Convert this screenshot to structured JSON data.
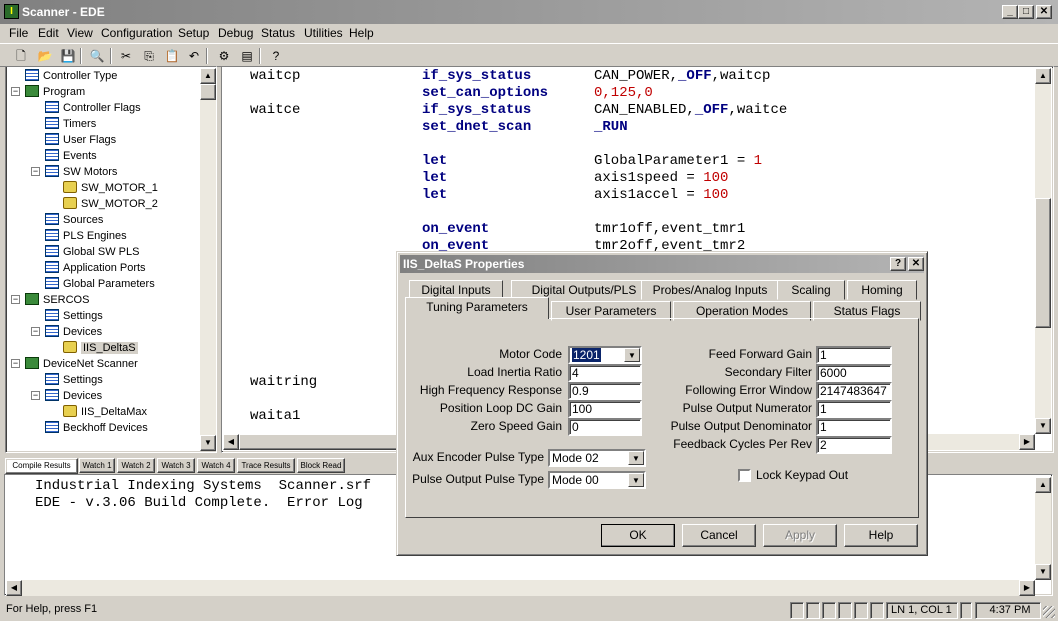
{
  "window": {
    "title": "Scanner - EDE",
    "app_icon": "I"
  },
  "menu": [
    "File",
    "Edit",
    "View",
    "Configuration",
    "Setup",
    "Debug",
    "Status",
    "Utilities",
    "Help"
  ],
  "toolbar": {
    "icons": [
      "new-file-icon",
      "open-folder-icon",
      "save-icon",
      "find-icon",
      "cut-icon",
      "copy-icon",
      "paste-icon",
      "undo-icon",
      "compile-icon",
      "build-icon",
      "help-icon"
    ]
  },
  "tree": {
    "items": [
      {
        "label": "Controller Type",
        "depth": 1,
        "icon": "grid"
      },
      {
        "label": "Program",
        "depth": 0,
        "icon": "folder",
        "expander": "−"
      },
      {
        "label": "Controller Flags",
        "depth": 2,
        "icon": "grid"
      },
      {
        "label": "Timers",
        "depth": 2,
        "icon": "grid"
      },
      {
        "label": "User Flags",
        "depth": 2,
        "icon": "grid"
      },
      {
        "label": "Events",
        "depth": 2,
        "icon": "grid"
      },
      {
        "label": "SW Motors",
        "depth": 2,
        "icon": "grid",
        "expander": "−"
      },
      {
        "label": "SW_MOTOR_1",
        "depth": 3,
        "icon": "dev"
      },
      {
        "label": "SW_MOTOR_2",
        "depth": 3,
        "icon": "dev"
      },
      {
        "label": "Sources",
        "depth": 2,
        "icon": "grid"
      },
      {
        "label": "PLS Engines",
        "depth": 2,
        "icon": "grid"
      },
      {
        "label": "Global SW PLS",
        "depth": 2,
        "icon": "grid"
      },
      {
        "label": "Application Ports",
        "depth": 2,
        "icon": "grid"
      },
      {
        "label": "Global Parameters",
        "depth": 2,
        "icon": "grid"
      },
      {
        "label": "SERCOS",
        "depth": 0,
        "icon": "folder",
        "expander": "−"
      },
      {
        "label": "Settings",
        "depth": 2,
        "icon": "grid"
      },
      {
        "label": "Devices",
        "depth": 2,
        "icon": "grid",
        "expander": "−"
      },
      {
        "label": "IIS_DeltaS",
        "depth": 3,
        "icon": "dev",
        "selected": true
      },
      {
        "label": "DeviceNet Scanner",
        "depth": 0,
        "icon": "folder",
        "expander": "−"
      },
      {
        "label": "Settings",
        "depth": 2,
        "icon": "grid"
      },
      {
        "label": "Devices",
        "depth": 2,
        "icon": "grid",
        "expander": "−"
      },
      {
        "label": "IIS_DeltaMax",
        "depth": 3,
        "icon": "dev"
      },
      {
        "label": "Beckhoff Devices",
        "depth": 2,
        "icon": "grid"
      }
    ]
  },
  "editor": {
    "lines": [
      {
        "label": "waitcp",
        "cmd": "if_sys_status",
        "args": [
          [
            "CAN_POWER,",
            ""
          ],
          [
            "_OFF",
            "kw"
          ],
          [
            ",waitcp",
            ""
          ]
        ]
      },
      {
        "label": "",
        "cmd": "set_can_options",
        "args": [
          [
            "0,125,0",
            "num"
          ]
        ]
      },
      {
        "label": "waitce",
        "cmd": "if_sys_status",
        "args": [
          [
            "CAN_ENABLED,",
            ""
          ],
          [
            "_OFF",
            "kw"
          ],
          [
            ",waitce",
            ""
          ]
        ]
      },
      {
        "label": "",
        "cmd": "set_dnet_scan",
        "args": [
          [
            "_RUN",
            "kw"
          ]
        ]
      },
      {
        "label": "",
        "cmd": "",
        "args": []
      },
      {
        "label": "",
        "cmd": "let",
        "args": [
          [
            "GlobalParameter1 = ",
            ""
          ],
          [
            "1",
            "num"
          ]
        ]
      },
      {
        "label": "",
        "cmd": "let",
        "args": [
          [
            "axis1speed = ",
            ""
          ],
          [
            "100",
            "num"
          ]
        ]
      },
      {
        "label": "",
        "cmd": "let",
        "args": [
          [
            "axis1accel = ",
            ""
          ],
          [
            "100",
            "num"
          ]
        ]
      },
      {
        "label": "",
        "cmd": "",
        "args": []
      },
      {
        "label": "",
        "cmd": "on_event",
        "args": [
          [
            "tmr1off,event_tmr1",
            ""
          ]
        ]
      },
      {
        "label": "",
        "cmd": "on_event",
        "args": [
          [
            "tmr2off,event_tmr2",
            ""
          ]
        ]
      },
      {
        "label": "",
        "cmd": "",
        "args": []
      },
      {
        "label": "",
        "cmd": "",
        "args": []
      },
      {
        "label": "",
        "cmd": "",
        "args": []
      },
      {
        "label": "",
        "cmd": "",
        "args": []
      },
      {
        "label": "",
        "cmd": "",
        "args": []
      },
      {
        "label": "",
        "cmd": "",
        "args": []
      },
      {
        "label": "",
        "cmd": "",
        "args": []
      },
      {
        "label": "waitring",
        "cmd": "",
        "args": []
      },
      {
        "label": "",
        "cmd": "",
        "args": []
      },
      {
        "label": "waita1",
        "cmd": "",
        "args": []
      }
    ]
  },
  "output_tabs": [
    "Compile Results",
    "Watch 1",
    "Watch 2",
    "Watch 3",
    "Watch 4",
    "Trace Results",
    "Block Read"
  ],
  "output_lines": [
    "Industrial Indexing Systems  Scanner.srf",
    "EDE - v.3.06 Build Complete.  Error Log"
  ],
  "status": {
    "help": "For Help, press F1",
    "position": "LN 1, COL 1",
    "time": "4:37 PM"
  },
  "dialog": {
    "title": "IIS_DeltaS Properties",
    "help_btn": "?",
    "close_btn": "✕",
    "tabs_row1": [
      "Digital Inputs",
      "Digital Outputs/PLS",
      "Probes/Analog Inputs",
      "Scaling",
      "Homing"
    ],
    "tabs_row2": [
      "Tuning Parameters",
      "User Parameters",
      "Operation Modes",
      "Status Flags"
    ],
    "left_fields": [
      {
        "label": "Motor Code",
        "value": "1201",
        "combo": true
      },
      {
        "label": "Load Inertia Ratio",
        "value": "4"
      },
      {
        "label": "High Frequency Response",
        "value": "0.9"
      },
      {
        "label": "Position Loop DC Gain",
        "value": "100"
      },
      {
        "label": "Zero Speed Gain",
        "value": "0"
      }
    ],
    "right_fields": [
      {
        "label": "Feed Forward Gain",
        "value": "1"
      },
      {
        "label": "Secondary Filter",
        "value": "6000"
      },
      {
        "label": "Following Error Window",
        "value": "2147483647"
      },
      {
        "label": "Pulse Output Numerator",
        "value": "1"
      },
      {
        "label": "Pulse Output Denominator",
        "value": "1"
      },
      {
        "label": "Feedback Cycles Per Rev",
        "value": "2"
      }
    ],
    "aux_encoder": {
      "label": "Aux Encoder Pulse Type",
      "value": "Mode 02"
    },
    "pulse_output": {
      "label": "Pulse Output Pulse Type",
      "value": "Mode 00"
    },
    "lock_keypad": {
      "label": "Lock Keypad Out",
      "checked": false
    },
    "buttons": {
      "ok": "OK",
      "cancel": "Cancel",
      "apply": "Apply",
      "help": "Help"
    }
  }
}
